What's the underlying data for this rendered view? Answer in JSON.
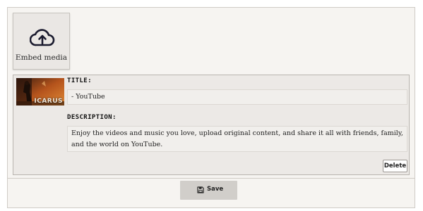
{
  "embed": {
    "label": "Embed media",
    "icon": "cloud-upload-icon"
  },
  "media_card": {
    "thumbnail": {
      "icon": "video-thumbnail-image",
      "caption": "ICARUS"
    },
    "title_label": "Title:",
    "title_value": "- YouTube",
    "description_label": "Description:",
    "description_value": "Enjoy the videos and music you love, upload original content, and share it all with friends, family, and the world on YouTube.",
    "delete_label": "Delete"
  },
  "footer": {
    "save_label": "Save",
    "save_icon": "floppy-disk-icon"
  }
}
